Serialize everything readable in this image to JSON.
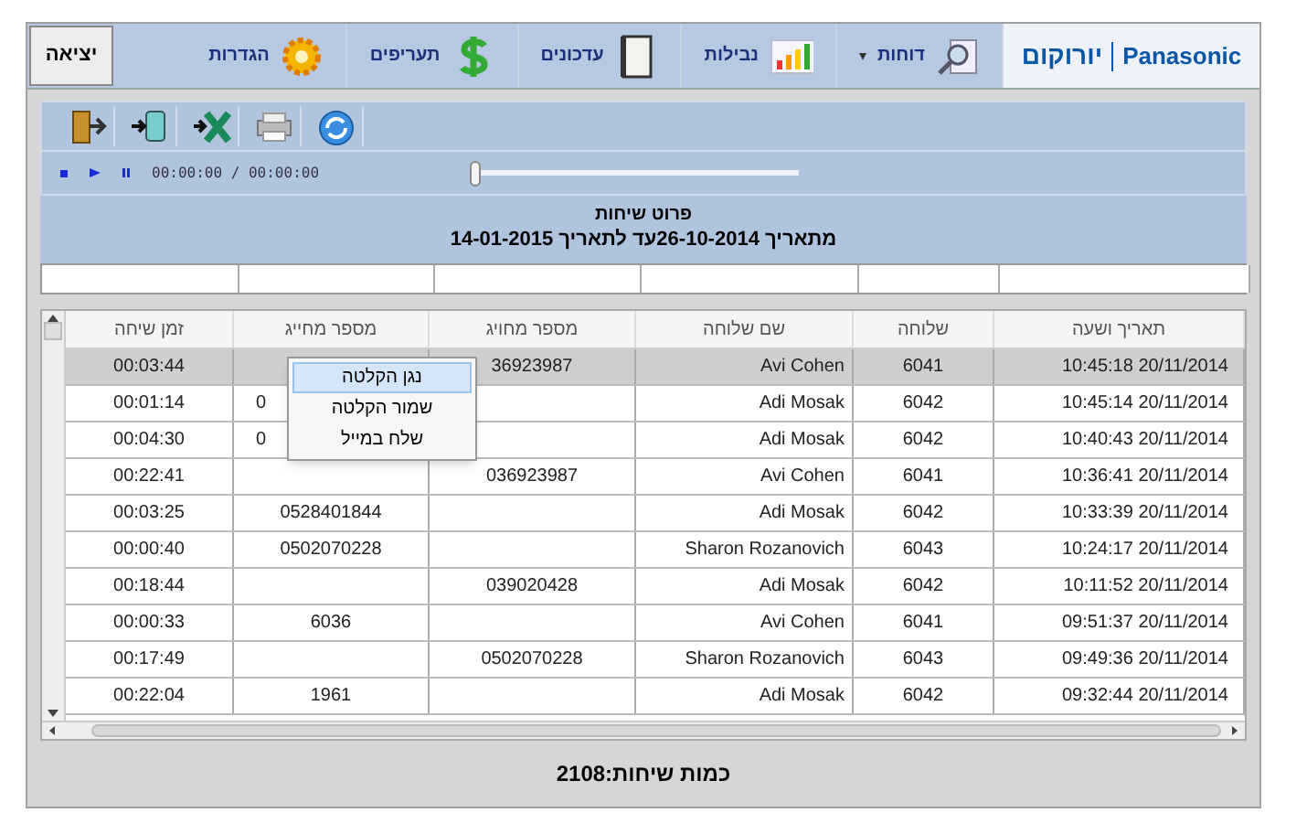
{
  "top_bar": {
    "logo": {
      "hebrew": "יורוקום",
      "brand": "Panasonic"
    },
    "menu": [
      {
        "kind": "reports",
        "label": "דוחות",
        "dropdown": true
      },
      {
        "kind": "chart",
        "label": "נבילות",
        "dropdown": false
      },
      {
        "kind": "notebook",
        "label": "עדכונים",
        "dropdown": false
      },
      {
        "kind": "dollar",
        "label": "תעריפים",
        "dropdown": false
      },
      {
        "kind": "gear",
        "label": "הגדרות",
        "dropdown": false
      }
    ],
    "exit_button": "יציאה"
  },
  "toolbar": [
    {
      "kind": "exit"
    },
    {
      "kind": "import"
    },
    {
      "kind": "excel"
    },
    {
      "kind": "print"
    },
    {
      "kind": "refresh"
    }
  ],
  "player": {
    "time": "00:00:00 / 00:00:00",
    "level": 0
  },
  "report": {
    "title": "פרוט שיחות",
    "range": "מתאריך 26-10-2014עד לתאריך 14-01-2015"
  },
  "table": {
    "columns": [
      "זמן שיחה",
      "מספר מחייג",
      "מספר מחויג",
      "שם שלוחה",
      "שלוחה",
      "תאריך ושעה"
    ],
    "rows": [
      {
        "selected": true,
        "cells": [
          "00:03:44",
          "",
          "36923987",
          "Avi Cohen",
          "6041",
          "10:45:18 20/11/2014"
        ]
      },
      {
        "selected": false,
        "partial": true,
        "cells": [
          "00:01:14",
          "0",
          "",
          "Adi Mosak",
          "6042",
          "10:45:14 20/11/2014"
        ]
      },
      {
        "selected": false,
        "partial": true,
        "cells": [
          "00:04:30",
          "0",
          "",
          "Adi Mosak",
          "6042",
          "10:40:43 20/11/2014"
        ]
      },
      {
        "selected": false,
        "cells": [
          "00:22:41",
          "",
          "036923987",
          "Avi Cohen",
          "6041",
          "10:36:41 20/11/2014"
        ]
      },
      {
        "selected": false,
        "cells": [
          "00:03:25",
          "0528401844",
          "",
          "Adi Mosak",
          "6042",
          "10:33:39 20/11/2014"
        ]
      },
      {
        "selected": false,
        "cells": [
          "00:00:40",
          "0502070228",
          "",
          "Sharon Rozanovich",
          "6043",
          "10:24:17 20/11/2014"
        ]
      },
      {
        "selected": false,
        "cells": [
          "00:18:44",
          "",
          "039020428",
          "Adi Mosak",
          "6042",
          "10:11:52 20/11/2014"
        ]
      },
      {
        "selected": false,
        "cells": [
          "00:00:33",
          "6036",
          "",
          "Avi Cohen",
          "6041",
          "09:51:37 20/11/2014"
        ]
      },
      {
        "selected": false,
        "cells": [
          "00:17:49",
          "",
          "0502070228",
          "Sharon Rozanovich",
          "6043",
          "09:49:36 20/11/2014"
        ]
      },
      {
        "selected": false,
        "cells": [
          "00:22:04",
          "1961",
          "",
          "Adi Mosak",
          "6042",
          "09:32:44 20/11/2014"
        ]
      }
    ]
  },
  "context_menu": [
    {
      "label": "נגן הקלטה",
      "selected": true
    },
    {
      "label": "שמור הקלטה",
      "selected": false
    },
    {
      "label": "שלח במייל",
      "selected": false
    }
  ],
  "footer": "כמות שיחות:2108"
}
